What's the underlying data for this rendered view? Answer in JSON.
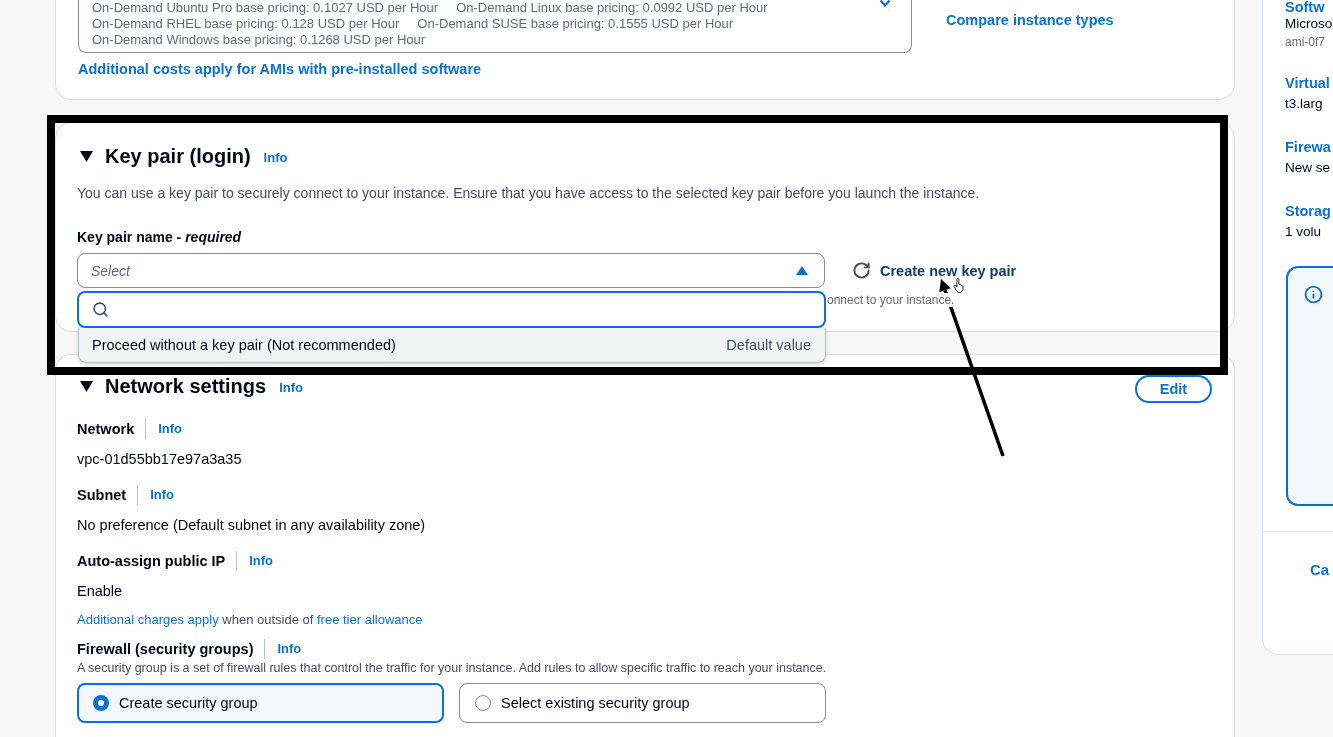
{
  "instance_type_section": {
    "pricing_rows": [
      [
        "On-Demand Ubuntu Pro base pricing: 0.1027 USD per Hour",
        "On-Demand Linux base pricing: 0.0992 USD per Hour"
      ],
      [
        "On-Demand RHEL base pricing: 0.128 USD per Hour",
        "On-Demand SUSE base pricing: 0.1555 USD per Hour"
      ],
      [
        "On-Demand Windows base pricing: 0.1268 USD per Hour"
      ]
    ],
    "compare_link": "Compare instance types",
    "additional_costs_link": "Additional costs apply for AMIs with pre-installed software"
  },
  "key_pair_section": {
    "expanded": true,
    "title": "Key pair (login)",
    "info_link": "Info",
    "description": "You can use a key pair to securely connect to your instance. Ensure that you have access to the selected key pair before you launch the instance.",
    "field_label": "Key pair name - *required*",
    "select": {
      "placeholder": "Select",
      "open": true
    },
    "create_button": "Create new key pair",
    "helper_text": "onnect to your instance.",
    "dropdown_options": [
      {
        "label": "Proceed without a key pair (Not recommended)",
        "tag": "Default value",
        "highlighted": true
      }
    ]
  },
  "network_section": {
    "expanded": true,
    "title": "Network settings",
    "info_link": "Info",
    "edit_button": "Edit",
    "fields": [
      {
        "label": "Network",
        "info_link": "Info",
        "value": "vpc-01d55bb17e97a3a35"
      },
      {
        "label": "Subnet",
        "info_link": "Info",
        "value": "No preference (Default subnet in any availability zone)"
      },
      {
        "label": "Auto-assign public IP",
        "info_link": "Info",
        "value": "Enable",
        "note": [
          {
            "kind": "link",
            "text": "Additional charges apply"
          },
          {
            "kind": "text",
            "text": "when outside of"
          },
          {
            "kind": "link",
            "text": "free tier allowance"
          }
        ]
      }
    ],
    "firewall": {
      "label": "Firewall (security groups)",
      "info_link": "Info",
      "description": "A security group is a set of firewall rules that control the traffic for your instance. Add rules to allow specific traffic to reach your instance.",
      "options": [
        {
          "label": "Create security group",
          "selected": true
        },
        {
          "label": "Select existing security group",
          "selected": false
        }
      ]
    }
  },
  "summary_panel": {
    "items": [
      {
        "label": "Softw",
        "value": "Microso",
        "detail": "ami-0f7"
      },
      {
        "label": "Virtual",
        "value": "t3.larg"
      },
      {
        "label": "Firewa",
        "value": "New se"
      },
      {
        "label": "Storag",
        "value": "1 volu"
      }
    ],
    "cancel_button": "Ca"
  }
}
